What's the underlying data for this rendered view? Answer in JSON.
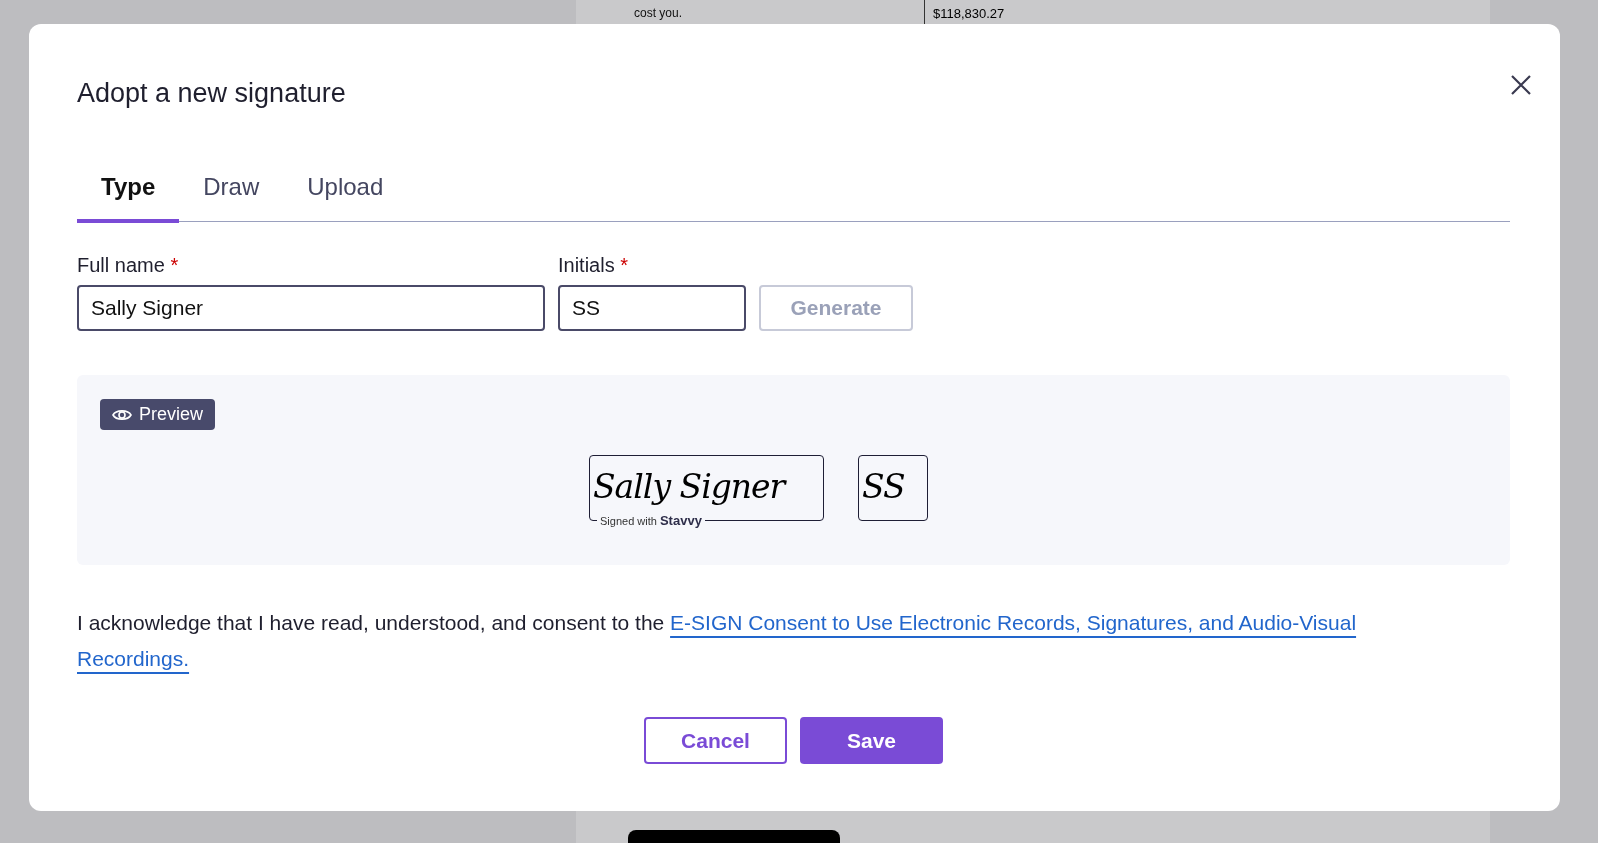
{
  "background_document": {
    "finance_text": "cost you.",
    "amount": "$118,830.27"
  },
  "dialog": {
    "title": "Adopt a new signature",
    "tabs": [
      {
        "label": "Type",
        "selected": true
      },
      {
        "label": "Draw",
        "selected": false
      },
      {
        "label": "Upload",
        "selected": false
      }
    ],
    "fields": [
      {
        "label": "Full name",
        "required_mark": "*",
        "value": "Sally Signer"
      },
      {
        "label": "Initials",
        "required_mark": "*",
        "value": "SS"
      }
    ],
    "generate_button": {
      "label": "Generate",
      "disabled": true
    },
    "preview": {
      "badge": "Preview",
      "signature": "Sally Signer",
      "signed_with": "Signed with **Stavvy**",
      "initials": "SS"
    },
    "consent": {
      "text": "I acknowledge that I have read, understood, and consent to the",
      "link": "E-SIGN Consent to Use Electronic Records, Signatures, and Audio-Visual Recordings."
    },
    "buttons": [
      {
        "label": "Cancel",
        "kind": "secondary"
      },
      {
        "label": "Save",
        "kind": "primary"
      }
    ]
  }
}
